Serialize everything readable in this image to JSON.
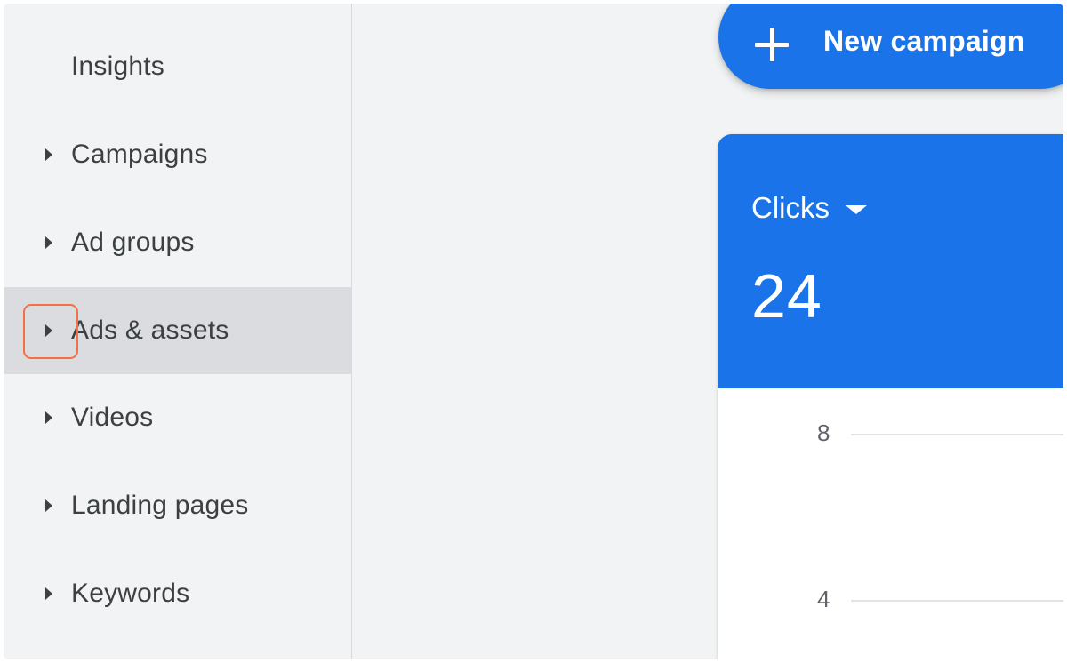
{
  "sidebar": {
    "items": [
      {
        "label": "Insights",
        "has_caret": false,
        "selected": false
      },
      {
        "label": "Campaigns",
        "has_caret": true,
        "selected": false
      },
      {
        "label": "Ad groups",
        "has_caret": true,
        "selected": false
      },
      {
        "label": "Ads & assets",
        "has_caret": true,
        "selected": true
      },
      {
        "label": "Videos",
        "has_caret": true,
        "selected": false
      },
      {
        "label": "Landing pages",
        "has_caret": true,
        "selected": false
      },
      {
        "label": "Keywords",
        "has_caret": true,
        "selected": false
      }
    ]
  },
  "toolbar": {
    "new_campaign_label": "New campaign",
    "new_campaign_icon": "plus-icon"
  },
  "metric_card": {
    "metric_name": "Clicks",
    "metric_value": "24",
    "selector_icon": "dropdown-caret-icon",
    "y_ticks": [
      "8",
      "4"
    ]
  },
  "colors": {
    "accent": "#1a73e8",
    "sidebar_bg": "#f1f3f4",
    "selected_bg": "#dadce0",
    "highlight": "#f56f45"
  }
}
